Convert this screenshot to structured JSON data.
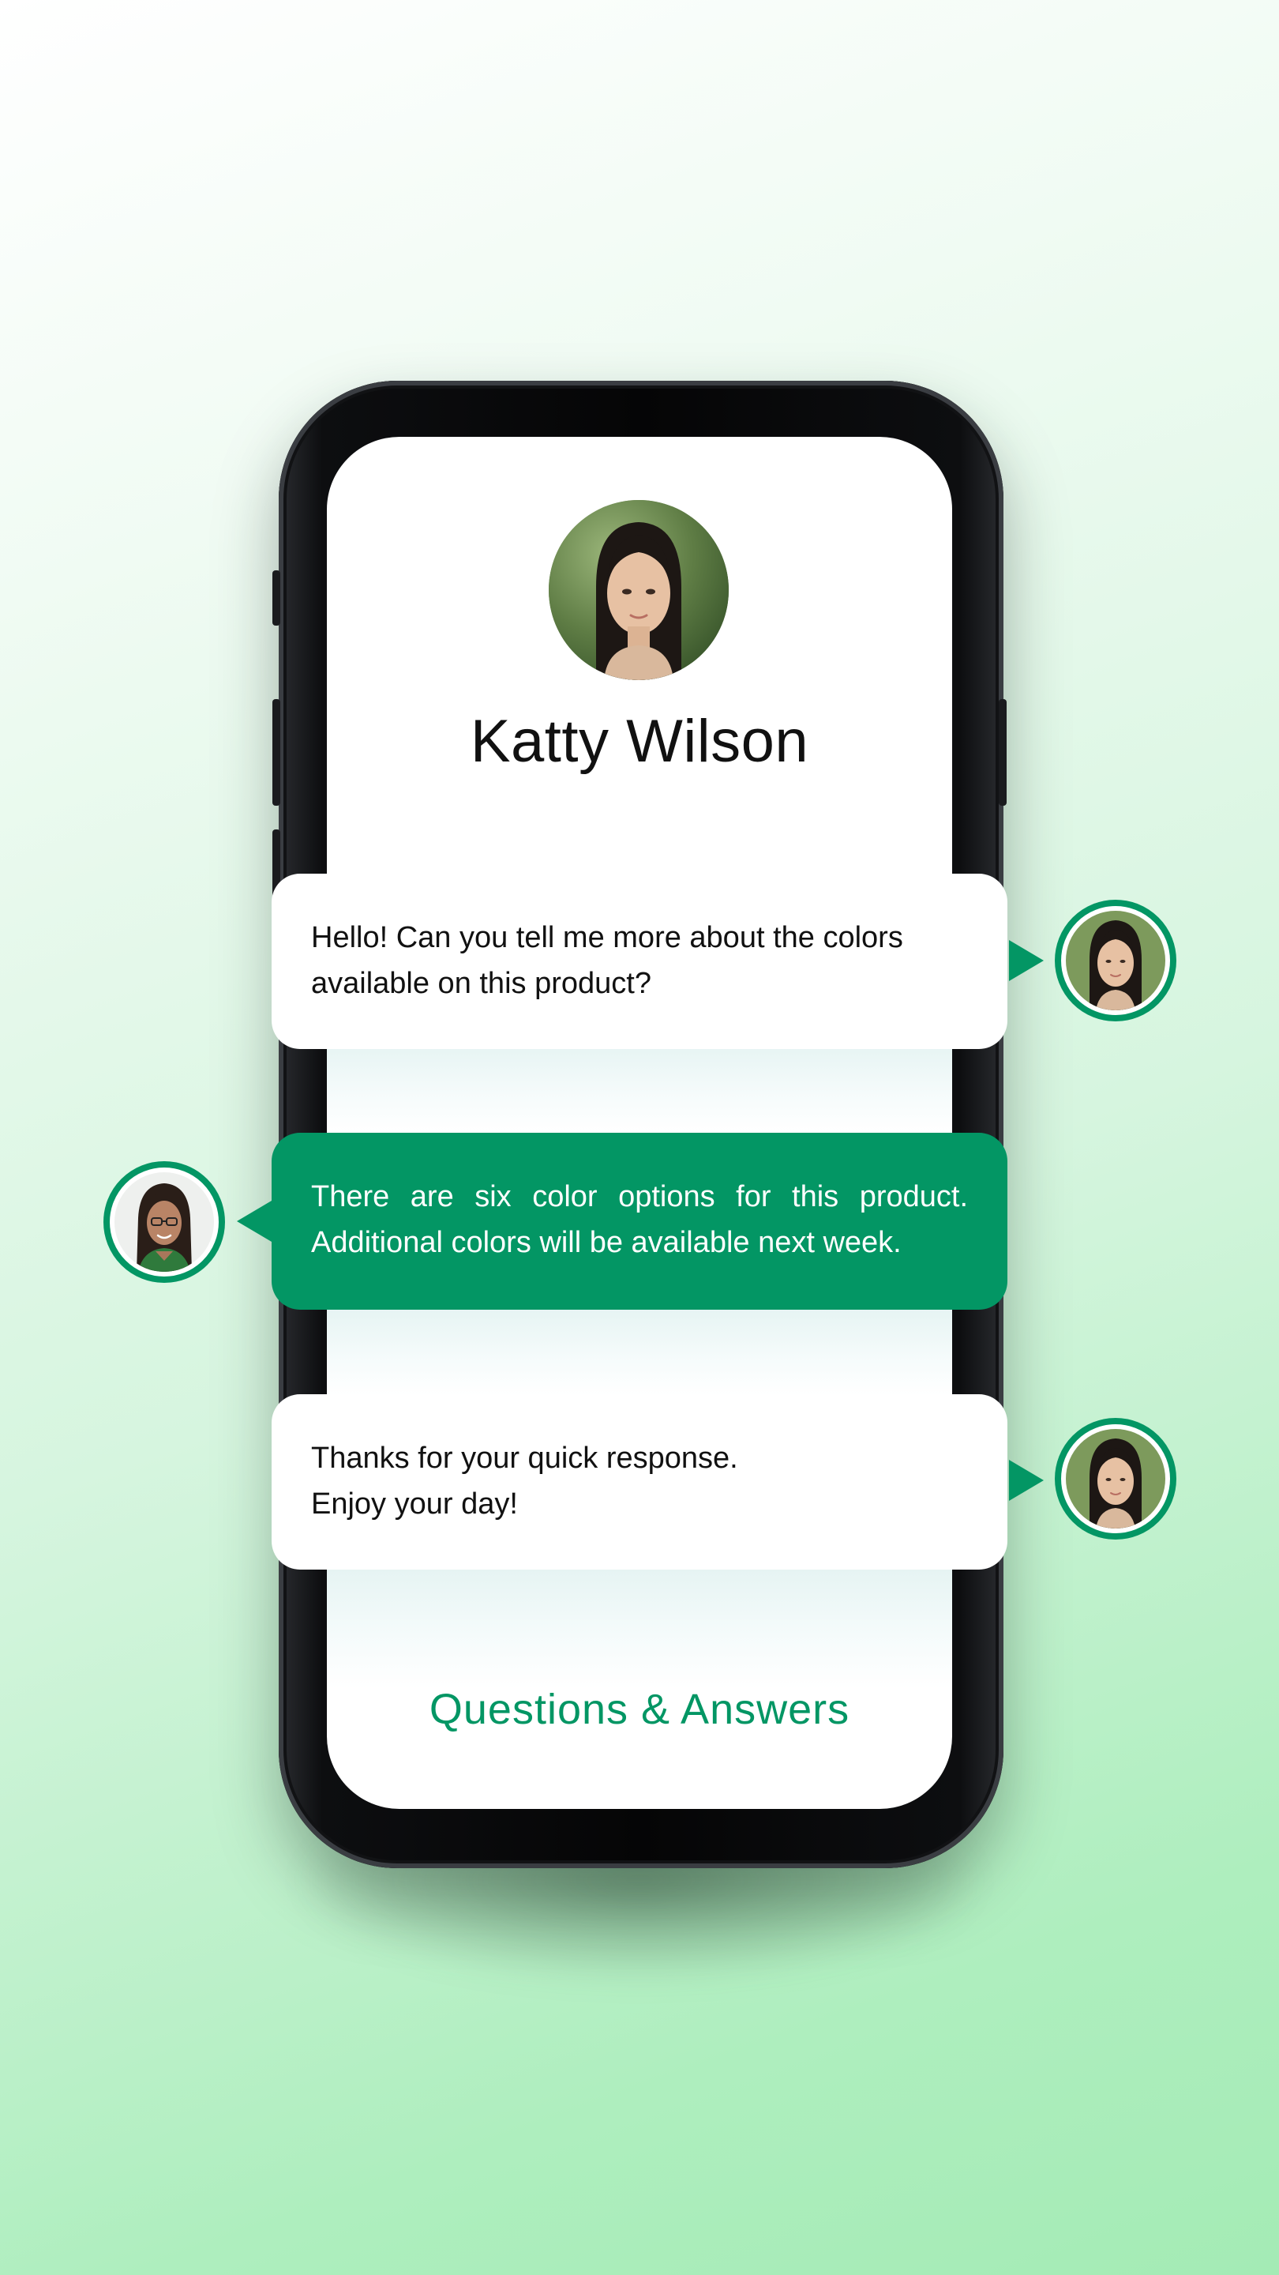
{
  "profile": {
    "name": "Katty Wilson",
    "avatar_icon": "woman-portrait"
  },
  "messages": [
    {
      "sender": "customer",
      "style": "light",
      "lines": [
        "Hello! Can you tell me more about the colors",
        "available on this product?"
      ],
      "avatar_icon": "woman-portrait"
    },
    {
      "sender": "agent",
      "style": "accent",
      "lines": [
        "There are six color options for this product.",
        "Additional colors will be available next week."
      ],
      "avatar_icon": "woman-with-glasses-portrait"
    },
    {
      "sender": "customer",
      "style": "light",
      "lines": [
        "Thanks for your quick response.",
        "Enjoy your day!"
      ],
      "avatar_icon": "woman-portrait"
    }
  ],
  "footer": {
    "title": "Questions & Answers"
  },
  "colors": {
    "accent": "#039664",
    "background_top": "#ffffff",
    "background_bottom": "#a4ebb5",
    "text": "#111111"
  }
}
